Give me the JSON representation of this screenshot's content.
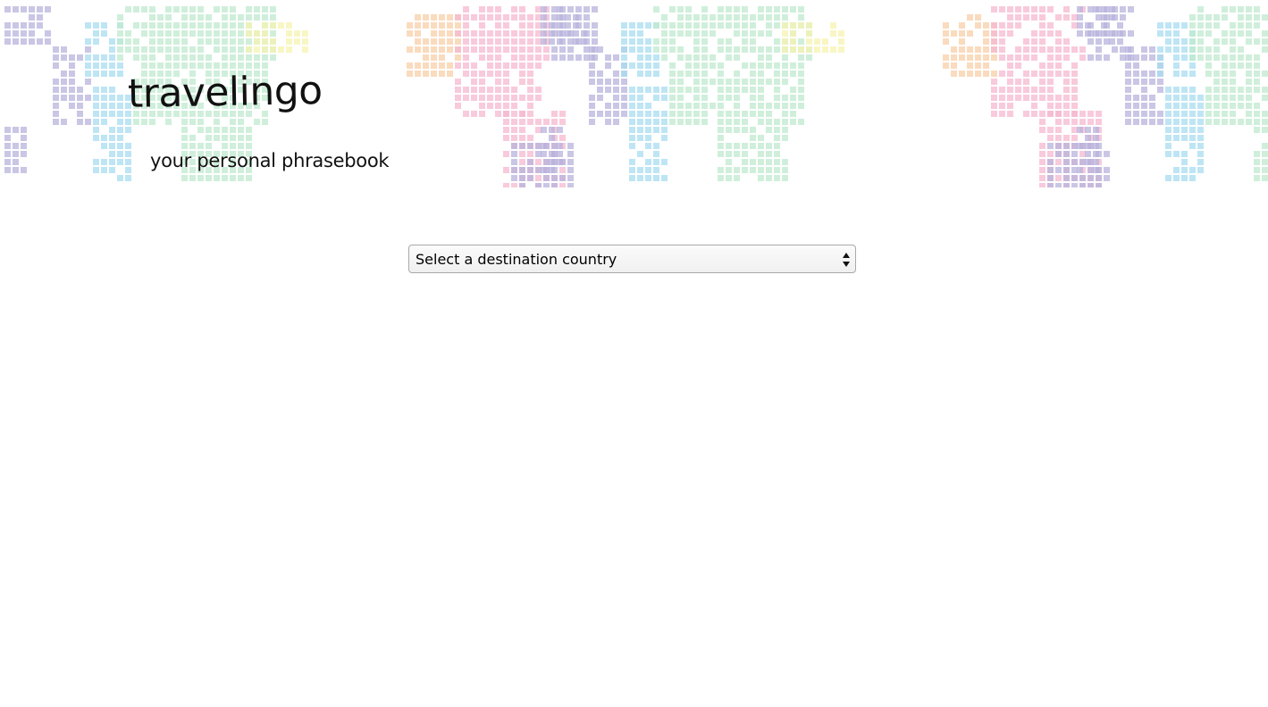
{
  "header": {
    "logo_text": "travelingo",
    "tagline": "your personal phrasebook",
    "background_icon": "world-map-pixel-pattern"
  },
  "country_select": {
    "selected_label": "Select a destination country",
    "icon": "select-arrows-icon"
  },
  "palette": {
    "purple": "#b8b3dc",
    "blue": "#a8dcf0",
    "green": "#bfe9cf",
    "yellow": "#f6f3b0",
    "pink": "#f5b8cf",
    "orange": "#f8cfa8"
  }
}
